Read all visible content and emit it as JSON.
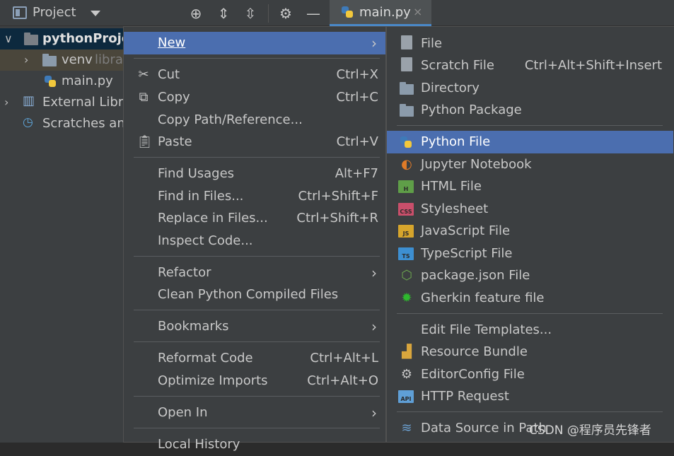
{
  "toolbar": {
    "project_label": "Project",
    "icons": [
      "locate-icon",
      "expand-all-icon",
      "collapse-all-icon",
      "gear-icon",
      "hide-icon"
    ],
    "tab_label": "main.py",
    "tab_close": "×"
  },
  "tree": {
    "root": "pythonProje",
    "venv": "venv",
    "venv_hint": "libra",
    "main": "main.py",
    "external": "External Libra",
    "scratches": "Scratches and"
  },
  "menu": {
    "new": "New",
    "cut": "Cut",
    "cut_sc": "Ctrl+X",
    "copy": "Copy",
    "copy_sc": "Ctrl+C",
    "copy_path": "Copy Path/Reference...",
    "paste": "Paste",
    "paste_sc": "Ctrl+V",
    "find_usages": "Find Usages",
    "find_usages_sc": "Alt+F7",
    "find_in_files": "Find in Files...",
    "find_in_files_sc": "Ctrl+Shift+F",
    "replace_in_files": "Replace in Files...",
    "replace_in_files_sc": "Ctrl+Shift+R",
    "inspect_code": "Inspect Code...",
    "refactor": "Refactor",
    "clean_python": "Clean Python Compiled Files",
    "bookmarks": "Bookmarks",
    "reformat_code": "Reformat Code",
    "reformat_code_sc": "Ctrl+Alt+L",
    "optimize_imports": "Optimize Imports",
    "optimize_imports_sc": "Ctrl+Alt+O",
    "open_in": "Open In",
    "local_history": "Local History"
  },
  "submenu": {
    "file": "File",
    "scratch_file": "Scratch File",
    "scratch_file_sc": "Ctrl+Alt+Shift+Insert",
    "directory": "Directory",
    "python_package": "Python Package",
    "python_file": "Python File",
    "jupyter": "Jupyter Notebook",
    "html_file": "HTML File",
    "stylesheet": "Stylesheet",
    "javascript": "JavaScript File",
    "typescript": "TypeScript File",
    "package_json": "package.json File",
    "gherkin": "Gherkin feature file",
    "edit_templates": "Edit File Templates...",
    "resource_bundle": "Resource Bundle",
    "editorconfig": "EditorConfig File",
    "http_request": "HTTP Request",
    "data_source": "Data Source in Path",
    "badges": {
      "html": "H",
      "css": "CSS",
      "js": "JS",
      "ts": "TS",
      "api": "API"
    }
  },
  "watermark": "CSDN @程序员先锋者",
  "colors": {
    "highlight": "#4b6eaf",
    "background": "#3c3f41",
    "selected_row": "#0d293e"
  }
}
